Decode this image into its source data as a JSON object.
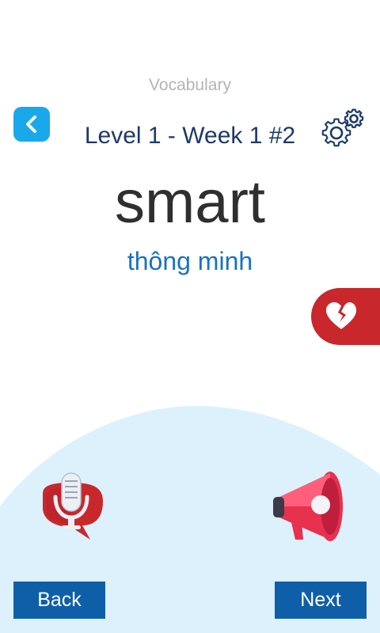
{
  "header": {
    "section": "Vocabulary",
    "title": "Level 1 - Week 1 #2"
  },
  "card": {
    "word": "smart",
    "translation": "thông minh"
  },
  "buttons": {
    "back_label": "Back",
    "next_label": "Next"
  },
  "icons": {
    "back": "chevron-left-icon",
    "settings": "gear-icon",
    "favorite": "broken-heart-icon",
    "record": "microphone-icon",
    "listen": "megaphone-icon"
  },
  "colors": {
    "accent_blue": "#19a9ea",
    "title_navy": "#1b3a6b",
    "translation_blue": "#1672c4",
    "button_blue": "#0f5fa8",
    "favorite_red": "#c8282c",
    "background_blob": "#dcf1fc"
  }
}
